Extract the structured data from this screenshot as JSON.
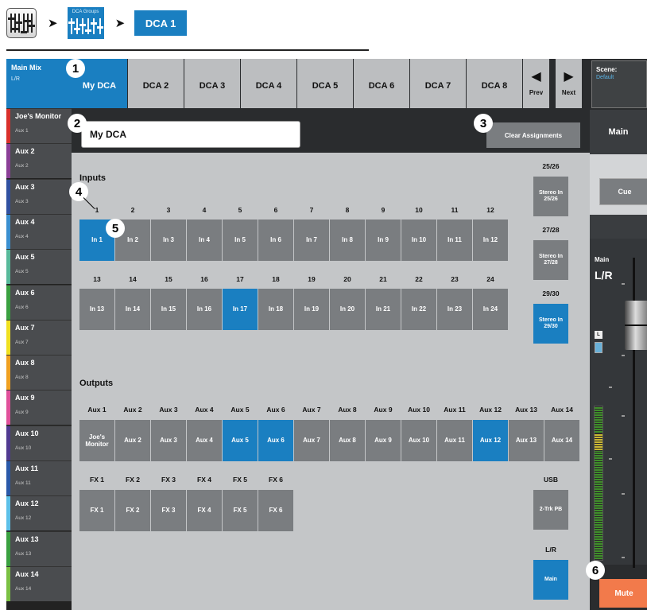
{
  "breadcrumb": {
    "dca_groups_label": "DCA Groups",
    "current": "DCA 1",
    "separator": "➤"
  },
  "left_panel": {
    "main_mix": {
      "name": "Main Mix",
      "sub": "L/R"
    },
    "mixes": [
      {
        "name": "Joe's Monitor",
        "sub": "Aux 1",
        "color": "#d9302b"
      },
      {
        "name": "Aux 2",
        "sub": "Aux 2",
        "color": "#8a3f96"
      },
      {
        "name": "Aux 3",
        "sub": "Aux 3",
        "color": "#3050a0"
      },
      {
        "name": "Aux 4",
        "sub": "Aux 4",
        "color": "#3a8fd0"
      },
      {
        "name": "Aux 5",
        "sub": "Aux 5",
        "color": "#57b99a"
      },
      {
        "name": "Aux 6",
        "sub": "Aux 6",
        "color": "#3aa040"
      },
      {
        "name": "Aux 7",
        "sub": "Aux 7",
        "color": "#f0e020"
      },
      {
        "name": "Aux 8",
        "sub": "Aux 8",
        "color": "#f0a020"
      },
      {
        "name": "Aux 9",
        "sub": "Aux 9",
        "color": "#e0509a"
      },
      {
        "name": "Aux 10",
        "sub": "Aux 10",
        "color": "#503a90"
      },
      {
        "name": "Aux 11",
        "sub": "Aux 11",
        "color": "#2a58a8"
      },
      {
        "name": "Aux 12",
        "sub": "Aux 12",
        "color": "#5cc0e8"
      },
      {
        "name": "Aux 13",
        "sub": "Aux 13",
        "color": "#3aa040"
      },
      {
        "name": "Aux 14",
        "sub": "Aux 14",
        "color": "#7ac043"
      }
    ]
  },
  "tabs": [
    "My DCA",
    "DCA 2",
    "DCA 3",
    "DCA 4",
    "DCA 5",
    "DCA 6",
    "DCA 7",
    "DCA 8"
  ],
  "active_tab": 0,
  "nav": {
    "prev": "Prev",
    "next": "Next"
  },
  "dca_name": "My DCA",
  "clear_assignments": "Clear Assignments",
  "inputs": {
    "heading": "Inputs",
    "row1_numbers": [
      "1",
      "2",
      "3",
      "4",
      "5",
      "6",
      "7",
      "8",
      "9",
      "10",
      "11",
      "12"
    ],
    "row1_buttons": [
      "In 1",
      "In 2",
      "In 3",
      "In 4",
      "In 5",
      "In 6",
      "In 7",
      "In 8",
      "In 9",
      "In 10",
      "In 11",
      "In 12"
    ],
    "row1_active": [
      true,
      false,
      false,
      false,
      false,
      false,
      false,
      false,
      false,
      false,
      false,
      false
    ],
    "row2_numbers": [
      "13",
      "14",
      "15",
      "16",
      "17",
      "18",
      "19",
      "20",
      "21",
      "22",
      "23",
      "24"
    ],
    "row2_buttons": [
      "In 13",
      "In 14",
      "In 15",
      "In 16",
      "In 17",
      "In 18",
      "In 19",
      "In 20",
      "In 21",
      "In 22",
      "In 23",
      "In 24"
    ],
    "row2_active": [
      false,
      false,
      false,
      false,
      true,
      false,
      false,
      false,
      false,
      false,
      false,
      false
    ],
    "stereo": [
      {
        "number": "25/26",
        "label": "Stereo In 25/26",
        "active": false
      },
      {
        "number": "27/28",
        "label": "Stereo In 27/28",
        "active": false
      },
      {
        "number": "29/30",
        "label": "Stereo In 29/30",
        "active": true
      }
    ]
  },
  "outputs": {
    "heading": "Outputs",
    "aux_headers": [
      "Aux 1",
      "Aux 2",
      "Aux 3",
      "Aux 4",
      "Aux 5",
      "Aux 6",
      "Aux 7",
      "Aux 8",
      "Aux 9",
      "Aux 10",
      "Aux 11",
      "Aux 12",
      "Aux 13",
      "Aux 14"
    ],
    "aux_buttons": [
      "Joe's Monitor",
      "Aux 2",
      "Aux 3",
      "Aux 4",
      "Aux 5",
      "Aux 6",
      "Aux 7",
      "Aux 8",
      "Aux 9",
      "Aux 10",
      "Aux 11",
      "Aux 12",
      "Aux 13",
      "Aux 14"
    ],
    "aux_active": [
      false,
      false,
      false,
      false,
      true,
      true,
      false,
      false,
      false,
      false,
      false,
      true,
      false,
      false
    ],
    "fx_headers": [
      "FX 1",
      "FX 2",
      "FX 3",
      "FX 4",
      "FX 5",
      "FX 6"
    ],
    "fx_buttons": [
      "FX 1",
      "FX 2",
      "FX 3",
      "FX 4",
      "FX 5",
      "FX 6"
    ],
    "usb": {
      "header": "USB",
      "label": "2-Trk PB"
    },
    "lr": {
      "header": "L/R",
      "label": "Main"
    }
  },
  "right_panel": {
    "scene_label": "Scene:",
    "scene_value": "Default",
    "main_tab": "Main",
    "cue": "Cue",
    "strip_label": "Main",
    "strip_name": "L/R",
    "l_badge": "L",
    "mute": "Mute"
  },
  "callouts": [
    "1",
    "2",
    "3",
    "4",
    "5",
    "6"
  ],
  "colors": {
    "accent": "#1a7fc1",
    "button": "#7a7d80",
    "panel": "#c4c6c8",
    "mute": "#f27a4b"
  }
}
